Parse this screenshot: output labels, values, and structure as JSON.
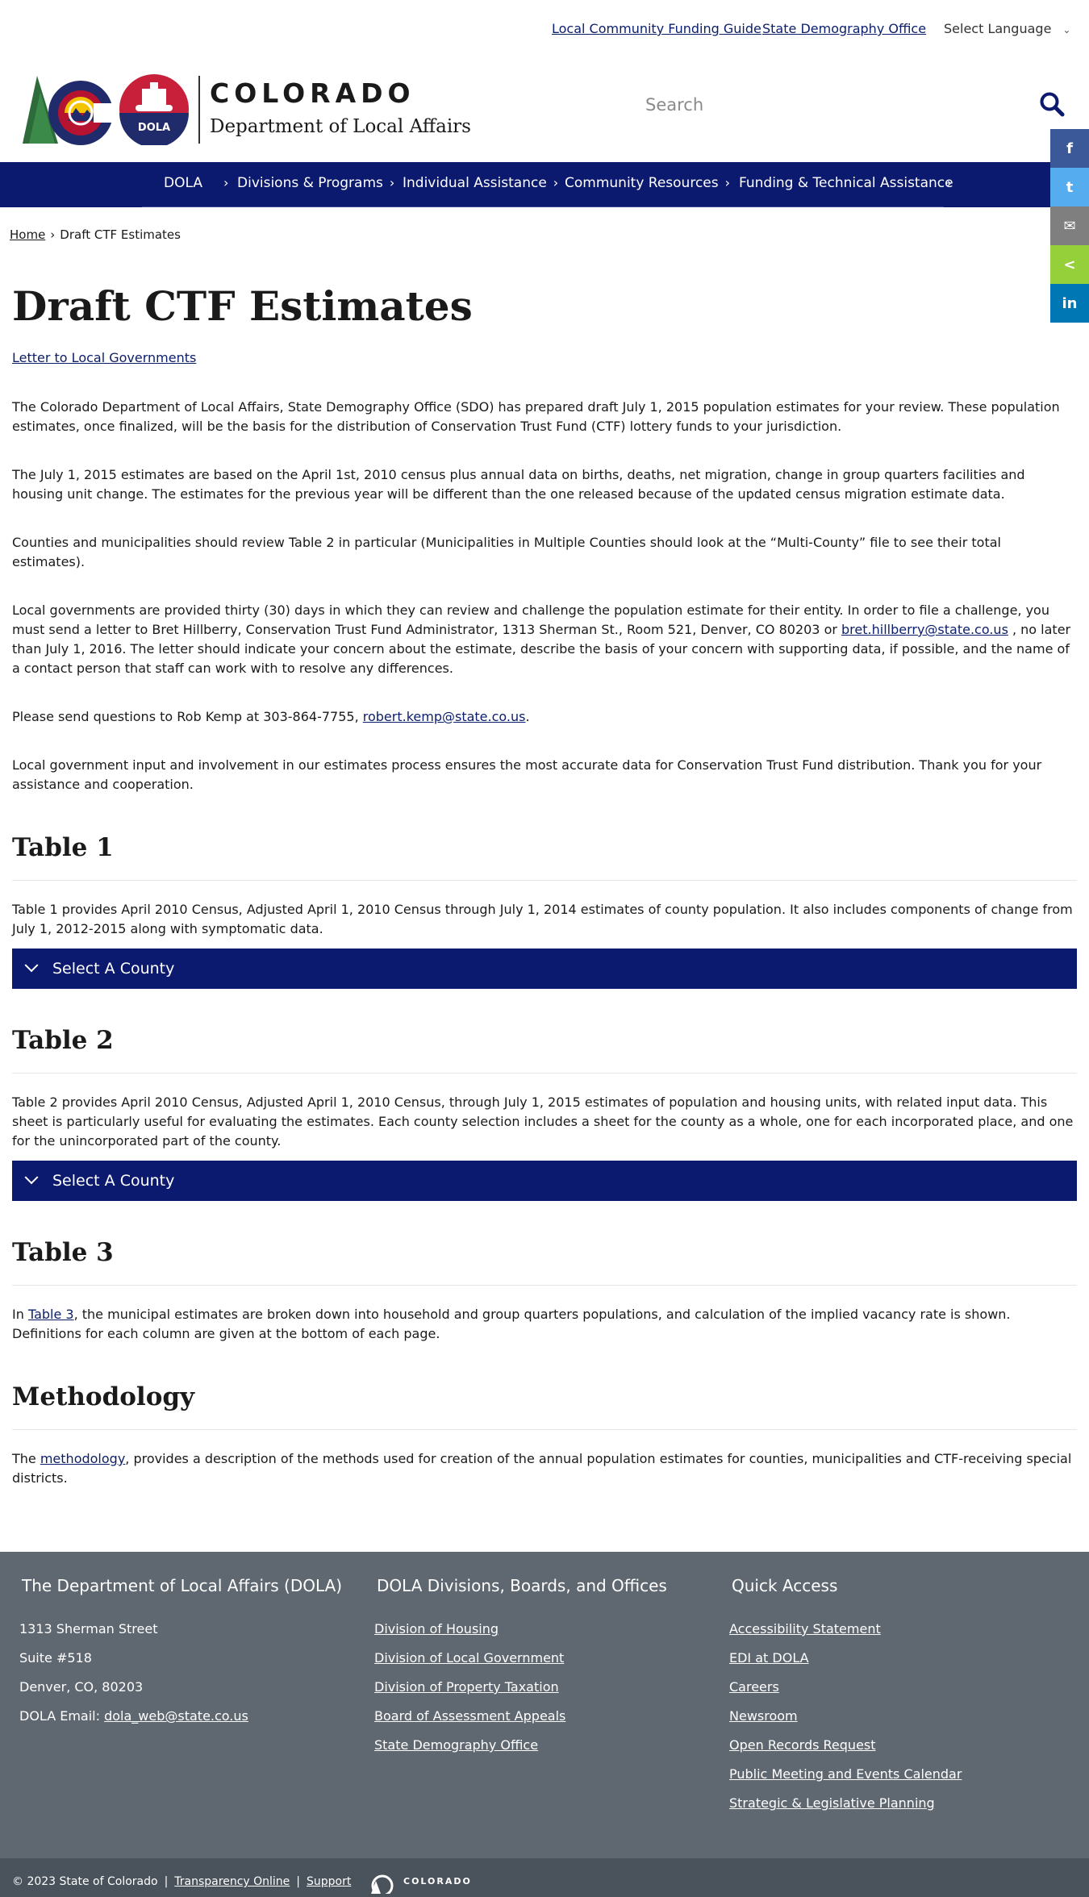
{
  "utility": {
    "link1": "Local Community Funding Guide",
    "link2": "State Demography Office",
    "language": "Select Language"
  },
  "header": {
    "logo_title": "COLORADO",
    "logo_subtitle": "Department of Local Affairs",
    "seal_text": "DOLA",
    "search_placeholder": "Search"
  },
  "nav": {
    "items": [
      {
        "label": "DOLA"
      },
      {
        "label": "Divisions & Programs"
      },
      {
        "label": "Individual Assistance"
      },
      {
        "label": "Community Resources"
      },
      {
        "label": "Funding & Technical Assistance"
      }
    ]
  },
  "share": {
    "facebook": "f",
    "twitter": "t",
    "email": "✉",
    "share": "<",
    "linkedin": "in"
  },
  "breadcrumb": {
    "home": "Home",
    "current": "Draft CTF Estimates"
  },
  "main": {
    "title": "Draft CTF Estimates",
    "letter_link": "Letter to Local Governments",
    "p1": "The Colorado Department of Local Affairs, State Demography Office (SDO) has prepared draft July 1, 2015 population estimates for your review. These population estimates, once finalized, will be the basis for the distribution of Conservation Trust Fund (CTF) lottery funds to your jurisdiction.",
    "p2": "The July 1, 2015 estimates are based on the April 1st, 2010 census plus annual data on births, deaths, net migration, change in group quarters facilities and housing unit change. The estimates for the previous year will be different than the one released because of the updated census migration estimate data.",
    "p3": "Counties and municipalities should review Table 2 in particular (Municipalities in Multiple Counties should look at the “Multi-County” file to see their total estimates).",
    "p4_a": "Local governments are provided thirty (30) days in which they can review and challenge the population estimate for their entity. In order to file a challenge, you must send a letter to Bret Hillberry, Conservation Trust Fund Administrator, 1313 Sherman St., Room 521, Denver, CO 80203 or ",
    "p4_email": "bret.hillberry@state.co.us",
    "p4_b": " , no later than July 1, 2016. The letter should indicate your concern about the estimate, describe the basis of your concern with supporting data, if possible, and the name of a contact person that staff can work with to resolve any differences.",
    "p5_a": "Please send questions to Rob Kemp at 303-864-7755, ",
    "p5_email": "robert.kemp@state.co.us",
    "p5_b": ".",
    "p6": "Local government input and involvement in our estimates process ensures the most accurate data for Conservation Trust Fund distribution. Thank you for your assistance and cooperation.",
    "table1_title": "Table 1",
    "table1_text": "Table 1 provides April 2010 Census, Adjusted April 1, 2010 Census through July 1, 2014 estimates of county population. It also includes components of change from July 1, 2012-2015 along with symptomatic data.",
    "table1_accordion": "Select A County",
    "table2_title": "Table 2",
    "table2_text": "Table 2 provides April 2010 Census, Adjusted April 1, 2010 Census, through July 1, 2015 estimates of population and housing units, with related input data. This sheet is particularly useful for evaluating the estimates. Each county selection includes a sheet for the county as a whole, one for each incorporated place, and one for the unincorporated part of the county.",
    "table2_accordion": "Select A County",
    "table3_title": "Table 3",
    "table3_a": "In ",
    "table3_link": "Table 3",
    "table3_b": ", the municipal estimates are broken down into household and group quarters populations, and calculation of the implied vacancy rate is shown. Definitions for each column are given at the bottom of each page.",
    "method_title": "Methodology",
    "method_a": "The ",
    "method_link": "methodology",
    "method_b": ", provides a description of the methods used for creation of the annual population estimates for counties, municipalities and CTF-receiving special districts."
  },
  "footer": {
    "col1": {
      "title": "The Department of Local Affairs (DOLA)",
      "address1": "1313 Sherman Street",
      "address2": "Suite  #518",
      "address3": "Denver, CO, 80203",
      "email_label": "DOLA Email: ",
      "email": "dola_web@state.co.us"
    },
    "col2": {
      "title": "DOLA Divisions, Boards, and Offices",
      "links": [
        "Division of Housing",
        "Division of Local Government",
        "Division of Property Taxation",
        "Board of Assessment Appeals",
        "State Demography Office"
      ]
    },
    "col3": {
      "title": "Quick Access",
      "links": [
        "Accessibility Statement",
        "EDI at DOLA",
        "Careers",
        "Newsroom",
        "Open Records Request",
        "Public Meeting and Events Calendar",
        "Strategic & Legislative Planning"
      ]
    },
    "copyright": "© 2023 State of Colorado",
    "transparency": "Transparency Online",
    "support": "Support",
    "portal_name": "COLORADO"
  },
  "colors": {
    "navy": "#0b1a6e",
    "footer": "#5f6770",
    "subfooter": "#4a525b"
  }
}
